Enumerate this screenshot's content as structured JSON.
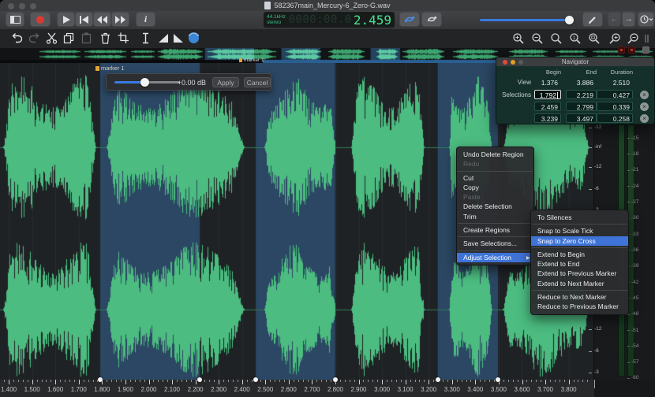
{
  "window": {
    "title": "582367main_Mercury-6_Zero-G.wav"
  },
  "lcd": {
    "sample_rate": "44.1kHz",
    "channel_mode": "stereo",
    "ghost_digits": "0000:00.0",
    "time": "2.459"
  },
  "gain_popup": {
    "gain_label": "+0.00 dB",
    "apply_label": "Apply",
    "cancel_label": "Cancel"
  },
  "marker": {
    "label": "marker 1"
  },
  "navigator": {
    "title": "Navigator",
    "columns": [
      "Begin",
      "End",
      "Duration"
    ],
    "view_row": {
      "label": "View",
      "begin": "1.376",
      "end": "3.886",
      "duration": "2.510"
    },
    "selections_label": "Selections",
    "selection_rows": [
      {
        "begin": "1.792",
        "end": "2.219",
        "duration": "0.427",
        "editing": true
      },
      {
        "begin": "2.459",
        "end": "2.799",
        "duration": "0.339",
        "editing": false
      },
      {
        "begin": "3.239",
        "end": "3.497",
        "duration": "0.258",
        "editing": false
      }
    ]
  },
  "context_menu": {
    "items": [
      {
        "label": "Undo Delete Region"
      },
      {
        "label": "Redo",
        "disabled": true
      },
      {
        "sep": true
      },
      {
        "label": "Cut"
      },
      {
        "label": "Copy"
      },
      {
        "label": "Paste",
        "disabled": true
      },
      {
        "label": "Delete Selection"
      },
      {
        "label": "Trim"
      },
      {
        "sep": true
      },
      {
        "label": "Create Regions"
      },
      {
        "sep": true
      },
      {
        "label": "Save Selections..."
      },
      {
        "sep": true
      },
      {
        "label": "Adjust Selection",
        "highlighted": true,
        "submenu": true
      }
    ]
  },
  "submenu": {
    "items": [
      {
        "label": "To Silences"
      },
      {
        "sep": true
      },
      {
        "label": "Snap to Scale Tick"
      },
      {
        "label": "Snap to Zero Cross",
        "highlighted": true
      },
      {
        "sep": true
      },
      {
        "label": "Extend to Begin"
      },
      {
        "label": "Extend to End"
      },
      {
        "label": "Extend to Previous Marker"
      },
      {
        "label": "Extend to Next Marker"
      },
      {
        "sep": true
      },
      {
        "label": "Reduce to Next Marker"
      },
      {
        "label": "Reduce to Previous Marker"
      }
    ]
  },
  "timeline": {
    "tick_labels": [
      "1.400",
      "1.500",
      "1.600",
      "1.700",
      "1.800",
      "1.900",
      "2.000",
      "2.100",
      "2.200",
      "2.300",
      "2.400",
      "2.500",
      "2.600",
      "2.700",
      "2.800",
      "2.900",
      "3.000",
      "3.100",
      "3.200",
      "3.300",
      "3.400",
      "3.500",
      "3.600",
      "3.700",
      "3.800"
    ]
  },
  "amp_scale": {
    "center_label": "-inf",
    "db_labels": [
      "-12",
      "-6",
      "-3"
    ]
  },
  "meter_scale": [
    "-15",
    "-18",
    "-21",
    "-24",
    "-27",
    "-30",
    "-33",
    "-36",
    "-39",
    "-42",
    "-45",
    "-48",
    "-51",
    "-54",
    "-57",
    "-60"
  ],
  "waveform": {
    "view_start": 1.376,
    "view_end": 3.886,
    "selections": [
      [
        1.792,
        2.219
      ],
      [
        2.459,
        2.799
      ],
      [
        3.239,
        3.497
      ]
    ],
    "bursts": [
      [
        1.378,
        1.772
      ],
      [
        1.82,
        2.408
      ],
      [
        2.496,
        2.8
      ],
      [
        2.868,
        3.18
      ],
      [
        3.288,
        3.47
      ],
      [
        3.52,
        3.884
      ]
    ],
    "marker_time": 1.792
  },
  "overview": {
    "bursts": [
      [
        0.35,
        0.7,
        0.55
      ],
      [
        0.74,
        1.1,
        0.6
      ],
      [
        1.15,
        1.35,
        0.45
      ],
      [
        1.38,
        1.77,
        1
      ],
      [
        1.82,
        2.41,
        1
      ],
      [
        2.5,
        2.8,
        1
      ],
      [
        2.87,
        3.18,
        1
      ],
      [
        3.29,
        3.47,
        1
      ],
      [
        3.52,
        3.88,
        1
      ],
      [
        3.96,
        4.35,
        0.85
      ],
      [
        4.45,
        4.78,
        0.8
      ],
      [
        4.86,
        5.12,
        0.5
      ],
      [
        5.18,
        5.45,
        0.45
      ],
      [
        5.5,
        5.7,
        0.4
      ]
    ],
    "marker_label": "marker 1"
  }
}
